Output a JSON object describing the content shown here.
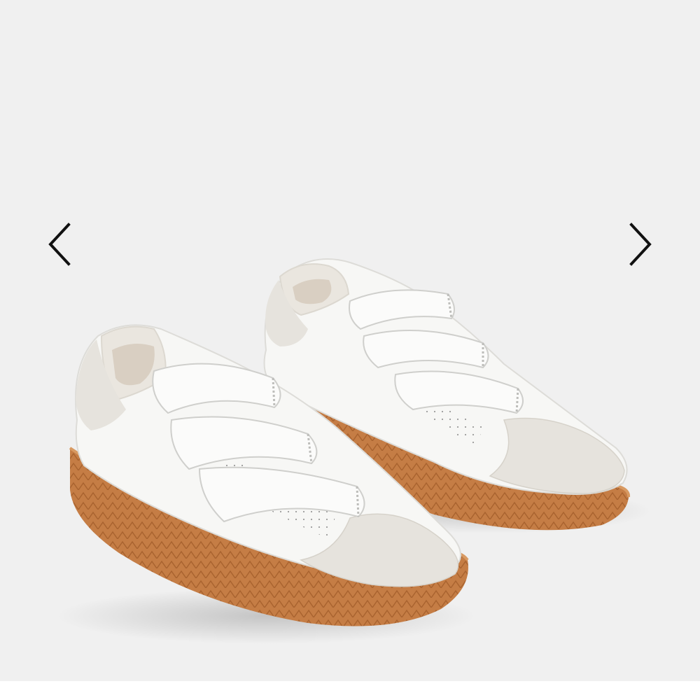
{
  "carousel": {
    "prev_icon": "chevron-left-icon",
    "next_icon": "chevron-right-icon",
    "background_color": "#f0f0f0",
    "product": {
      "type": "sneakers",
      "upper_color": "#f7f7f5",
      "suede_color": "#e6e3dd",
      "sole_color": "#c57d45",
      "strap_count": 3
    }
  }
}
